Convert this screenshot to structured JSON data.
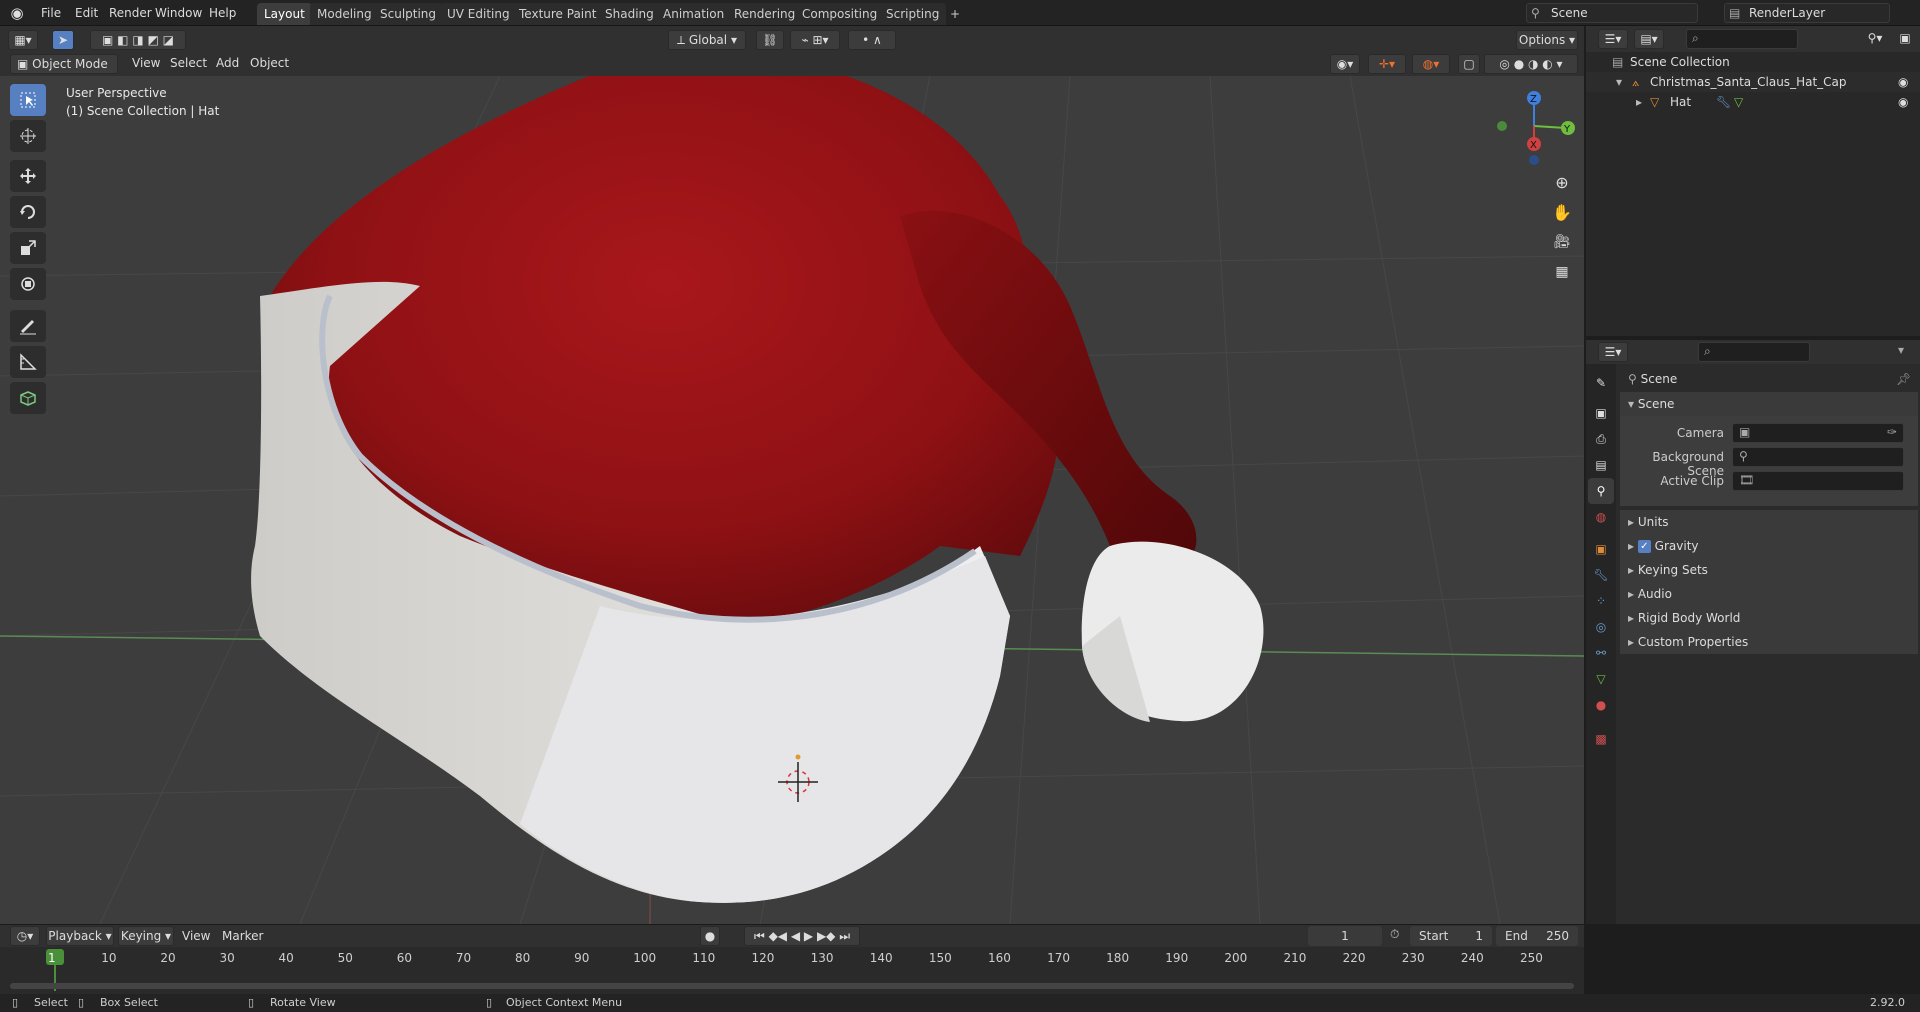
{
  "app": {
    "version": "2.92.0"
  },
  "menu": {
    "items": [
      "File",
      "Edit",
      "Render",
      "Window",
      "Help"
    ]
  },
  "workspaces": {
    "tabs": [
      "Layout",
      "Modeling",
      "Sculpting",
      "UV Editing",
      "Texture Paint",
      "Shading",
      "Animation",
      "Rendering",
      "Compositing",
      "Scripting"
    ],
    "active": "Layout",
    "add_label": "+"
  },
  "scene_field": "Scene",
  "render_layer_field": "RenderLayer",
  "viewport_header": {
    "mode": "Object Mode",
    "menus": [
      "View",
      "Select",
      "Add",
      "Object"
    ],
    "orientation": "Global",
    "options_label": "Options"
  },
  "viewport": {
    "perspective_label": "User Perspective",
    "collection_label": "(1) Scene Collection | Hat",
    "gizmo": {
      "z": "Z",
      "y": "Y",
      "x": "X"
    }
  },
  "outliner": {
    "root": "Scene Collection",
    "items": [
      {
        "name": "Christmas_Santa_Claus_Hat_Cap",
        "icon": "empty-icon"
      },
      {
        "name": "Hat",
        "icon": "mesh-icon"
      }
    ]
  },
  "properties": {
    "context": "Scene",
    "panel_title": "Scene",
    "fields": [
      {
        "label": "Camera",
        "value": ""
      },
      {
        "label": "Background Scene",
        "value": ""
      },
      {
        "label": "Active Clip",
        "value": ""
      }
    ],
    "subpanels": [
      "Units",
      "Gravity",
      "Keying Sets",
      "Audio",
      "Rigid Body World",
      "Custom Properties"
    ],
    "gravity_checked": true
  },
  "timeline": {
    "menus": [
      "Playback",
      "Keying",
      "View",
      "Marker"
    ],
    "current_frame": "1",
    "start_label": "Start",
    "start": "1",
    "end_label": "End",
    "end": "250",
    "ticks": [
      "1",
      "10",
      "20",
      "30",
      "40",
      "50",
      "60",
      "70",
      "80",
      "90",
      "100",
      "110",
      "120",
      "130",
      "140",
      "150",
      "160",
      "170",
      "180",
      "190",
      "200",
      "210",
      "220",
      "230",
      "240",
      "250"
    ]
  },
  "statusbar": {
    "select": "Select",
    "box_select": "Box Select",
    "rotate_view": "Rotate View",
    "context_menu": "Object Context Menu"
  },
  "colors": {
    "accent": "#5680c2",
    "hat_red": "#9b1316",
    "hat_white": "#e8e8ea",
    "viewport_bg": "#3d3d3d"
  }
}
